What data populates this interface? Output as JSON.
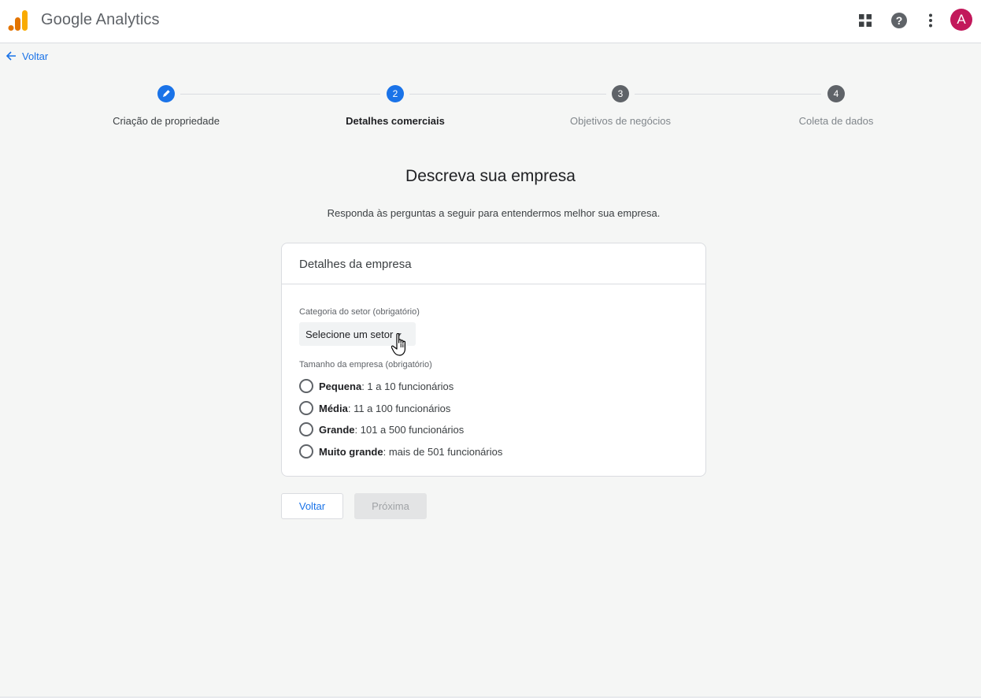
{
  "header": {
    "app_title": "Google Analytics",
    "icons": [
      "apps-icon",
      "help-icon",
      "more-vert-icon"
    ],
    "avatar_letter": "A",
    "avatar_color": "#c2185b"
  },
  "back_link": {
    "label": "Voltar"
  },
  "stepper": {
    "steps": [
      {
        "label": "Criação de propriedade",
        "state": "completed",
        "number": ""
      },
      {
        "label": "Detalhes comerciais",
        "state": "active",
        "number": "2"
      },
      {
        "label": "Objetivos de negócios",
        "state": "upcoming",
        "number": "3"
      },
      {
        "label": "Coleta de dados",
        "state": "upcoming",
        "number": "4"
      }
    ],
    "active_color": "#1a73e8",
    "upcoming_color": "#5f6368"
  },
  "main": {
    "title": "Descreva sua empresa",
    "subtitle": "Responda às perguntas a seguir para entendermos melhor sua empresa."
  },
  "card": {
    "title": "Detalhes da empresa",
    "sector_label": "Categoria do setor (obrigatório)",
    "sector_select_value": "Selecione um setor",
    "size_label": "Tamanho da empresa (obrigatório)",
    "size_options": [
      {
        "name": "Pequena",
        "desc": ": 1 a 10 funcionários"
      },
      {
        "name": "Média",
        "desc": ": 11 a 100 funcionários"
      },
      {
        "name": "Grande",
        "desc": ": 101 a 500 funcionários"
      },
      {
        "name": "Muito grande",
        "desc": ": mais de 501 funcionários"
      }
    ]
  },
  "buttons": {
    "back_label": "Voltar",
    "next_label": "Próxima",
    "next_enabled": false
  }
}
